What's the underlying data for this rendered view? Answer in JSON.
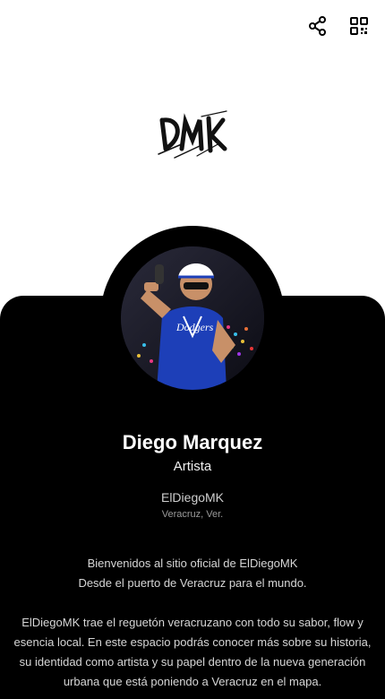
{
  "header": {
    "share_icon": "share-icon",
    "qr_icon": "qr-code-icon"
  },
  "logo": {
    "text": "DMK"
  },
  "profile": {
    "name": "Diego Marquez",
    "role": "Artista",
    "handle": "ElDiegoMK",
    "location": "Veracruz, Ver."
  },
  "bio": {
    "line1": "Bienvenidos al sitio oficial de ElDiegoMK",
    "line2": "Desde el puerto de Veracruz para el mundo.",
    "paragraph": "ElDiegoMK trae el reguetón veracruzano con todo su sabor, flow y esencia local. En este espacio podrás conocer más sobre su historia, su identidad como artista y su papel dentro de la nueva generación urbana que está poniendo a Veracruz en el mapa."
  },
  "colors": {
    "card_background": "#000000",
    "page_background": "#ffffff",
    "text_primary": "#ffffff",
    "text_muted": "#9a9a9a"
  }
}
